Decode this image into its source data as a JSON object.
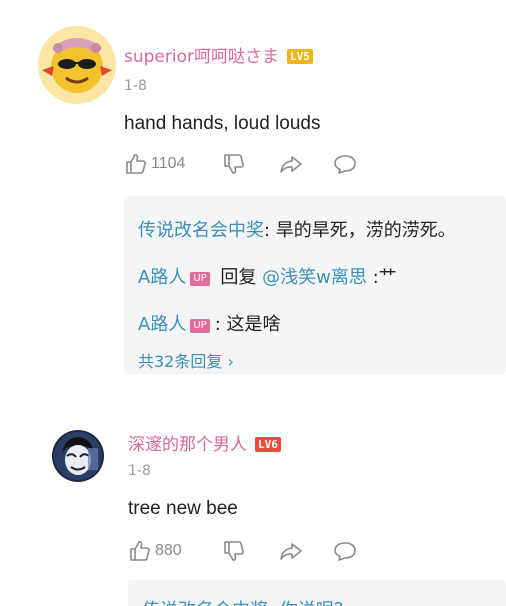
{
  "comments": [
    {
      "username": "superior呵呵哒さま",
      "level": "LV5",
      "date": "1-8",
      "text": "hand hands, loud louds",
      "likes": "1104",
      "replies": [
        {
          "name": "传说改名会中奖",
          "up": "",
          "sep": ": ",
          "text": "旱的旱死，涝的涝死。"
        },
        {
          "name": "A路人",
          "up": "UP",
          "sep": " 回复 ",
          "mention": "@浅笑w离思",
          "text": " :艹"
        },
        {
          "name": "A路人",
          "up": "UP",
          "sep": ": ",
          "text": "这是啥"
        }
      ],
      "more_replies": "共32条回复 ›"
    },
    {
      "username": "深邃的那个男人",
      "level": "LV6",
      "date": "1-8",
      "text": "tree new bee",
      "likes": "880",
      "partial_reply": "传说改名会中奖: 你说呢？"
    }
  ],
  "icons": {
    "like": "thumbs-up-icon",
    "dislike": "thumbs-down-icon",
    "share": "share-arrow-icon",
    "reply": "speech-bubble-icon"
  },
  "colors": {
    "username": "#d8699a",
    "reply_name": "#3d8fb8",
    "lv5": "#f2b418",
    "lv6": "#ef4b3d"
  }
}
